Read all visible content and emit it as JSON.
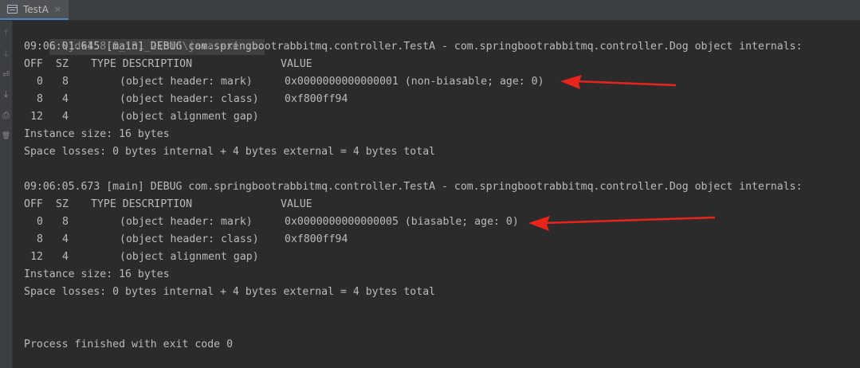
{
  "tab": {
    "label": "TestA",
    "close_glyph": "×",
    "icon": "console-window-icon"
  },
  "gutter": {
    "buttons": [
      {
        "name": "scroll-up-icon",
        "glyph": "↑"
      },
      {
        "name": "scroll-down-icon",
        "glyph": "↓"
      },
      {
        "name": "soft-wrap-icon",
        "glyph": "⏎"
      },
      {
        "name": "scroll-to-end-icon",
        "glyph": "⤓"
      },
      {
        "name": "print-icon",
        "glyph": "⎙"
      },
      {
        "name": "clear-all-icon",
        "glyph": "🗑"
      }
    ]
  },
  "console": {
    "command": "C:\\jdk1.8.0_131_2\\bin\\java.exe ...",
    "block1": {
      "log": "09:06:01.645 [main] DEBUG com.springbootrabbitmq.controller.TestA - com.springbootrabbitmq.controller.Dog object internals:",
      "header": {
        "off": "OFF",
        "sz": "SZ",
        "type_desc": "TYPE DESCRIPTION",
        "value": "VALUE"
      },
      "rows": [
        {
          "off": "0",
          "sz": "8",
          "desc": "(object header: mark)",
          "value": "0x0000000000000001 (non-biasable; age: 0)"
        },
        {
          "off": "8",
          "sz": "4",
          "desc": "(object header: class)",
          "value": "0xf800ff94"
        },
        {
          "off": "12",
          "sz": "4",
          "desc": "(object alignment gap)",
          "value": ""
        }
      ],
      "instance_size": "Instance size: 16 bytes",
      "space_losses": "Space losses: 0 bytes internal + 4 bytes external = 4 bytes total"
    },
    "block2": {
      "log": "09:06:05.673 [main] DEBUG com.springbootrabbitmq.controller.TestA - com.springbootrabbitmq.controller.Dog object internals:",
      "header": {
        "off": "OFF",
        "sz": "SZ",
        "type_desc": "TYPE DESCRIPTION",
        "value": "VALUE"
      },
      "rows": [
        {
          "off": "0",
          "sz": "8",
          "desc": "(object header: mark)",
          "value": "0x0000000000000005 (biasable; age: 0)"
        },
        {
          "off": "8",
          "sz": "4",
          "desc": "(object header: class)",
          "value": "0xf800ff94"
        },
        {
          "off": "12",
          "sz": "4",
          "desc": "(object alignment gap)",
          "value": ""
        }
      ],
      "instance_size": "Instance size: 16 bytes",
      "space_losses": "Space losses: 0 bytes internal + 4 bytes external = 4 bytes total"
    },
    "exit_message": "Process finished with exit code 0"
  },
  "annotations": {
    "arrow_color": "#e8241c"
  },
  "colors": {
    "background": "#2b2b2b",
    "text": "#bbbbbb",
    "tab_active_underline": "#4a88c7"
  }
}
